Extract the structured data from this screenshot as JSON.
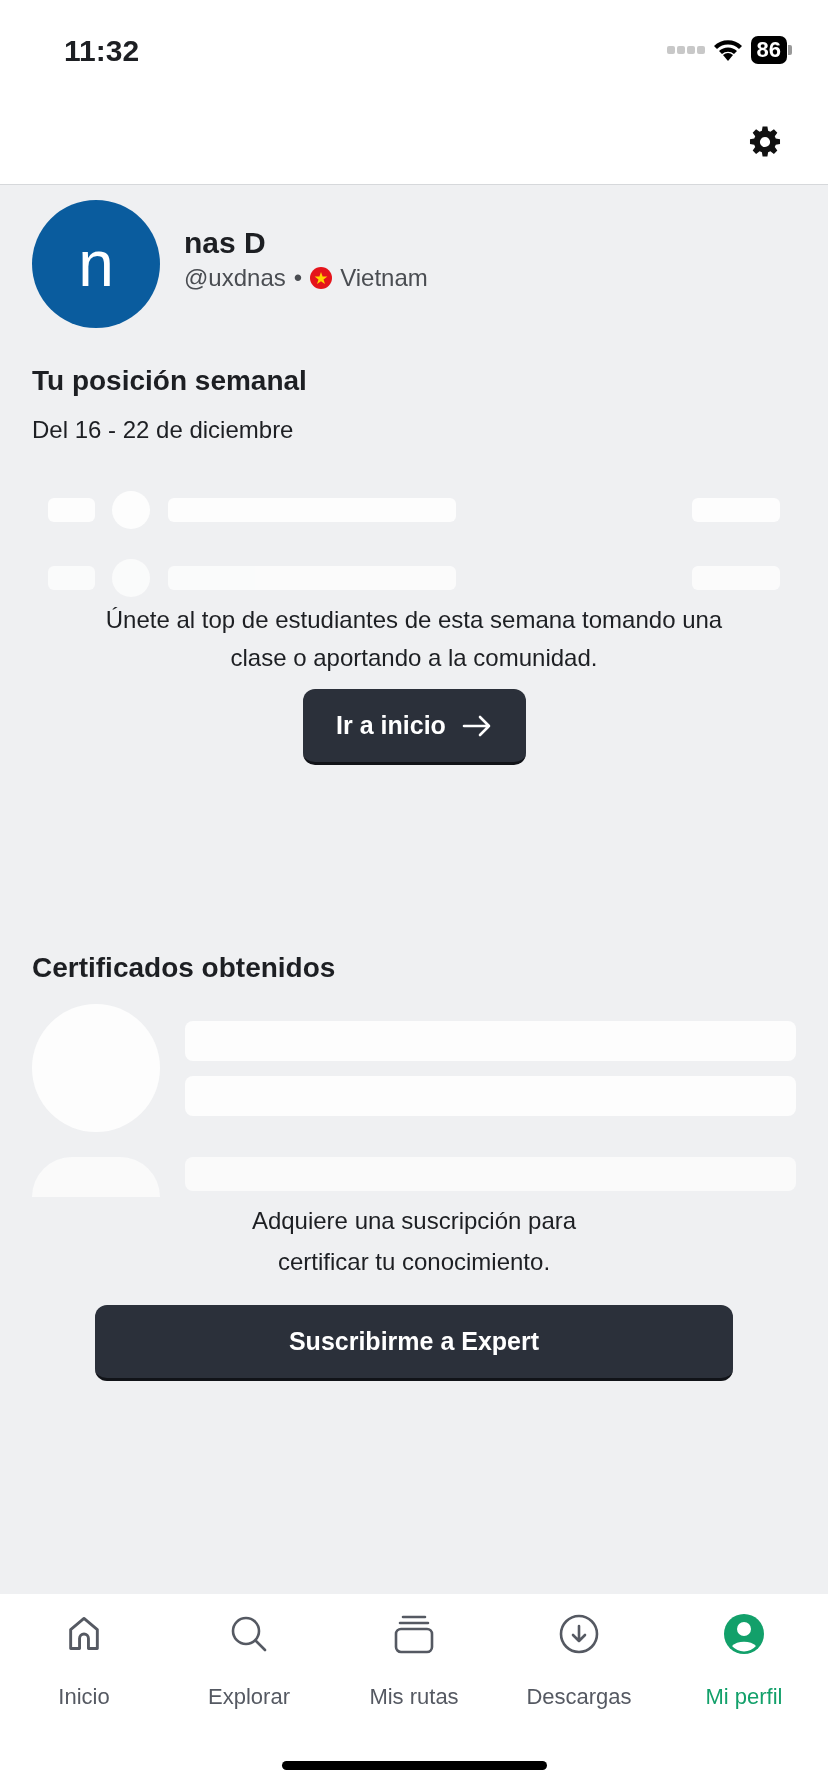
{
  "status_bar": {
    "time": "11:32",
    "battery": "86"
  },
  "profile": {
    "avatar_letter": "n",
    "name": "nas D",
    "handle": "@uxdnas",
    "separator": "•",
    "country": "Vietnam"
  },
  "weekly": {
    "title": "Tu posición semanal",
    "dates": "Del 16 - 22 de diciembre",
    "message": "Únete al top de estudiantes de esta semana tomando una clase o aportando a la comunidad.",
    "button": "Ir a inicio"
  },
  "certificates": {
    "title": "Certificados obtenidos",
    "message": "Adquiere una suscripción para certificar tu conocimiento.",
    "button": "Suscribirme a Expert"
  },
  "tab_bar": [
    {
      "label": "Inicio",
      "kind": "home",
      "selected": false
    },
    {
      "label": "Explorar",
      "kind": "search",
      "selected": false
    },
    {
      "label": "Mis rutas",
      "kind": "routes",
      "selected": false
    },
    {
      "label": "Descargas",
      "kind": "downloads",
      "selected": false
    },
    {
      "label": "Mi perfil",
      "kind": "profile",
      "selected": true
    }
  ]
}
